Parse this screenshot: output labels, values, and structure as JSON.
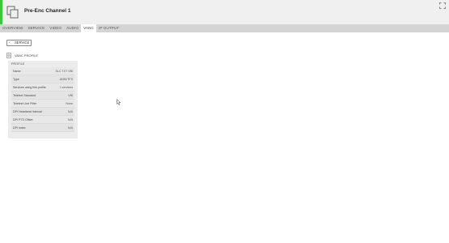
{
  "header": {
    "title": "Pre-Enc Channel 1",
    "accent_color": "#3cc83c",
    "icon": "copy-pages-icon",
    "expand_icon": "expand-arrows-icon"
  },
  "tabs": [
    {
      "label": "OVERVIEW",
      "active": false
    },
    {
      "label": "SERVICE",
      "active": false
    },
    {
      "label": "VIDEO",
      "active": false
    },
    {
      "label": "AUDIO",
      "active": false
    },
    {
      "label": "VANC",
      "active": true
    },
    {
      "label": "IP OUTPUT",
      "active": false
    }
  ],
  "back_button": {
    "label": "SERVICE",
    "icon": "chevron-left-icon"
  },
  "section": {
    "label": "VANC PROFILE",
    "icon": "document-icon"
  },
  "panel": {
    "label": "PROFILE",
    "rows": [
      {
        "key": "Name",
        "value": "SLC TXT VBI"
      },
      {
        "key": "Type",
        "value": "ANSI/TFS"
      },
      {
        "key": "Services using this profile",
        "value": "1 services"
      },
      {
        "key": "Teletext Standard",
        "value": "VBI"
      },
      {
        "key": "Teletext Line Filter",
        "value": "None"
      },
      {
        "key": "DPI Heartbeat Interval",
        "value": "N/A"
      },
      {
        "key": "DPI PTS Offset",
        "value": "N/A"
      },
      {
        "key": "DPI index",
        "value": "N/A"
      }
    ]
  }
}
